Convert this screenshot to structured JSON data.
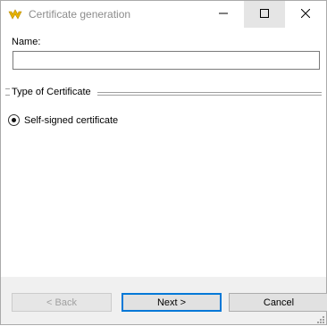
{
  "window": {
    "title": "Certificate generation"
  },
  "form": {
    "name_label": "Name:",
    "name_value": "",
    "group_title": "Type of Certificate",
    "radio_label": "Self-signed certificate"
  },
  "buttons": {
    "back": "< Back",
    "next": "Next >",
    "cancel": "Cancel"
  },
  "icons": {
    "app": "app-logo-icon",
    "minimize": "minimize-icon",
    "maximize": "maximize-icon",
    "close": "close-icon"
  },
  "colors": {
    "accent": "#0078d7",
    "footer": "#f0f0f0"
  }
}
